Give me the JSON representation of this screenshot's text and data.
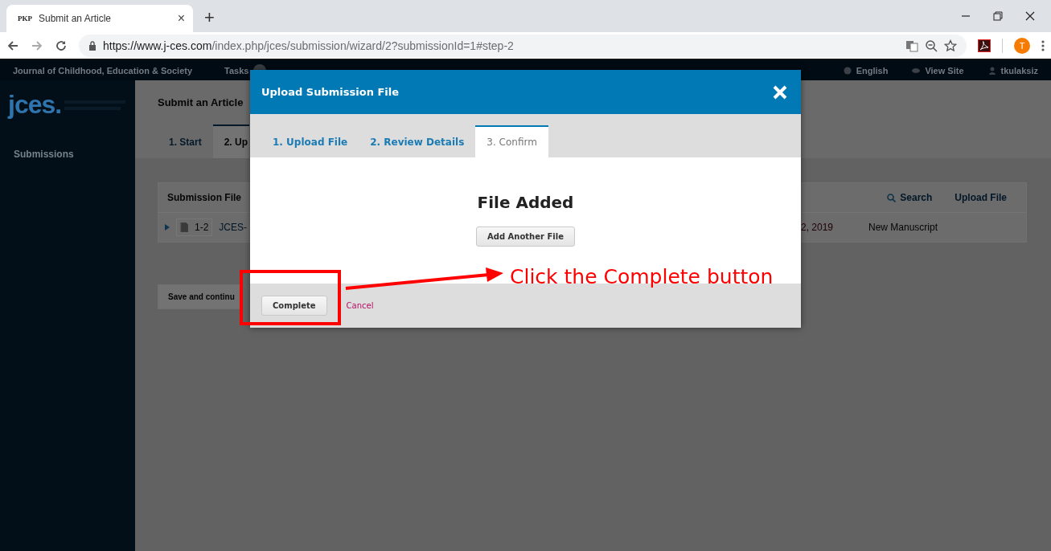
{
  "browser": {
    "tab": {
      "favicon": "PKP",
      "title": "Submit an Article",
      "close": "×"
    },
    "new_tab": "+",
    "url": {
      "host": "https://www.j-ces.com",
      "path": "/index.php/jces/submission/wizard/2?submissionId=1#step-2"
    },
    "profile_initial": "T"
  },
  "site": {
    "journal": "Journal of Childhood, Education & Society",
    "tasks": "Tasks",
    "user_links": [
      {
        "kind": "globe",
        "label": "English"
      },
      {
        "kind": "eye",
        "label": "View Site"
      },
      {
        "kind": "user",
        "label": "tkulaksiz"
      }
    ],
    "logo": "jces.",
    "sidebar": [
      "Submissions"
    ]
  },
  "page": {
    "title": "Submit an Article",
    "steps": [
      {
        "label": "1. Start",
        "selected": false
      },
      {
        "label": "2. Up",
        "selected": true
      }
    ],
    "files_panel": {
      "title": "Submission File",
      "actions": [
        {
          "kind": "search",
          "label": "Search"
        },
        {
          "kind": "plain",
          "label": "Upload File"
        }
      ],
      "rows": [
        {
          "id": "1-2",
          "name": "JCES-",
          "date": "2, 2019",
          "type": "New Manuscript"
        }
      ]
    },
    "save_button": "Save and continu"
  },
  "modal": {
    "title": "Upload Submission File",
    "tabs": [
      {
        "label": "1. Upload File",
        "selected": false
      },
      {
        "label": "2. Review Details",
        "selected": false
      },
      {
        "label": "3. Confirm",
        "selected": true
      }
    ],
    "heading": "File Added",
    "add_button": "Add Another File",
    "complete_button": "Complete",
    "cancel": "Cancel"
  },
  "annotation": {
    "text": "Click the Complete button"
  }
}
